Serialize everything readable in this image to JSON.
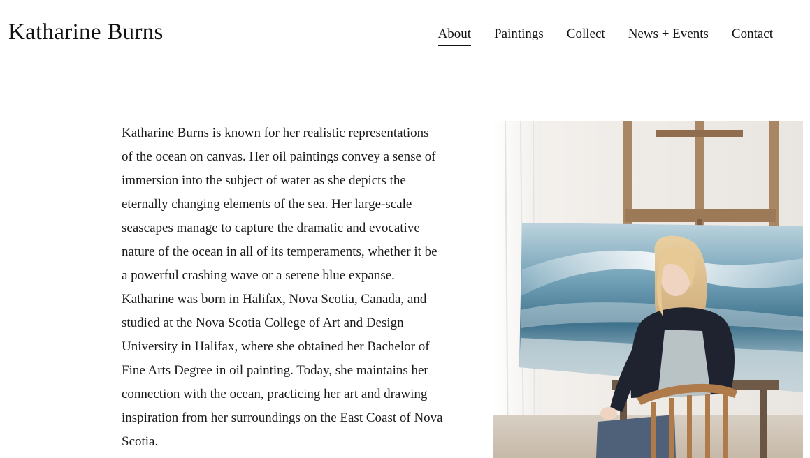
{
  "site": {
    "title": "Katharine Burns"
  },
  "nav": {
    "items": [
      {
        "label": "About",
        "active": true
      },
      {
        "label": "Paintings",
        "active": false
      },
      {
        "label": "Collect",
        "active": false
      },
      {
        "label": "News + Events",
        "active": false
      },
      {
        "label": "Contact",
        "active": false
      }
    ]
  },
  "bio": {
    "text": "Katharine Burns is known for her realistic representations of the ocean on canvas.  Her oil paintings convey a sense of immersion into the subject of water as she depicts the eternally changing elements of the sea.  Her large-scale seascapes manage to capture the dramatic and evocative nature of the ocean in all of its temperaments, whether it be a powerful crashing wave or a serene blue expanse.  Katharine was born in Halifax, Nova Scotia, Canada, and studied at the Nova Scotia College of Art and Design University in Halifax, where she obtained her Bachelor of Fine Arts Degree in oil painting.  Today, she maintains her connection with the ocean, practicing her art and drawing inspiration from her surroundings on the East Coast of Nova Scotia."
  },
  "colors": {
    "text": "#1c1c1c",
    "background": "#ffffff",
    "wave_blue": "#5f8fa8"
  }
}
